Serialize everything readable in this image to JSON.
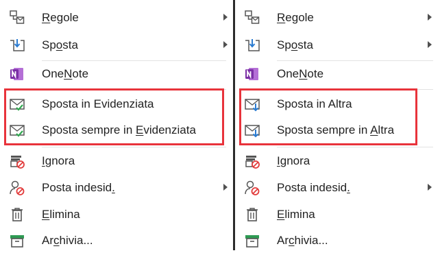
{
  "colors": {
    "highlight_border": "#e8333b",
    "onenote_purple": "#7b2fa6",
    "check_green": "#2fa84f",
    "arrow_blue": "#2a7bd1",
    "block_red": "#e23b3b",
    "archive_green": "#2e9b53"
  },
  "left_menu": {
    "rules": {
      "pre": "",
      "ul": "R",
      "post": "egole",
      "icon": "rules-icon"
    },
    "move": {
      "pre": "Sp",
      "ul": "o",
      "post": "sta",
      "icon": "move-icon"
    },
    "onenote": {
      "pre": "One",
      "ul": "N",
      "post": "ote",
      "icon": "onenote-icon"
    },
    "move_focused": {
      "pre": "Sposta in Evidenziata",
      "ul": "",
      "post": "",
      "icon": "envelope-check-icon"
    },
    "always_focused": {
      "pre": "Sposta sempre in ",
      "ul": "E",
      "post": "videnziata",
      "icon": "envelope-check-icon"
    },
    "ignore": {
      "pre": "",
      "ul": "I",
      "post": "gnora",
      "icon": "ignore-icon"
    },
    "junk": {
      "pre": "Posta indesid",
      "ul": ".",
      "post": "",
      "icon": "junk-icon"
    },
    "delete": {
      "pre": "",
      "ul": "E",
      "post": "limina",
      "icon": "trash-icon"
    },
    "archive": {
      "pre": "Ar",
      "ul": "c",
      "post": "hivia...",
      "icon": "archive-icon"
    }
  },
  "right_menu": {
    "rules": {
      "pre": "",
      "ul": "R",
      "post": "egole",
      "icon": "rules-icon"
    },
    "move": {
      "pre": "Sp",
      "ul": "o",
      "post": "sta",
      "icon": "move-icon"
    },
    "onenote": {
      "pre": "One",
      "ul": "N",
      "post": "ote",
      "icon": "onenote-icon"
    },
    "move_other": {
      "pre": "Sposta in Altra",
      "ul": "",
      "post": "",
      "icon": "envelope-arrow-icon"
    },
    "always_other": {
      "pre": "Sposta sempre in ",
      "ul": "A",
      "post": "ltra",
      "icon": "envelope-arrow-icon"
    },
    "ignore": {
      "pre": "",
      "ul": "I",
      "post": "gnora",
      "icon": "ignore-icon"
    },
    "junk": {
      "pre": "Posta indesid",
      "ul": ".",
      "post": "",
      "icon": "junk-icon"
    },
    "delete": {
      "pre": "",
      "ul": "E",
      "post": "limina",
      "icon": "trash-icon"
    },
    "archive": {
      "pre": "Ar",
      "ul": "c",
      "post": "hivia...",
      "icon": "archive-icon"
    }
  }
}
